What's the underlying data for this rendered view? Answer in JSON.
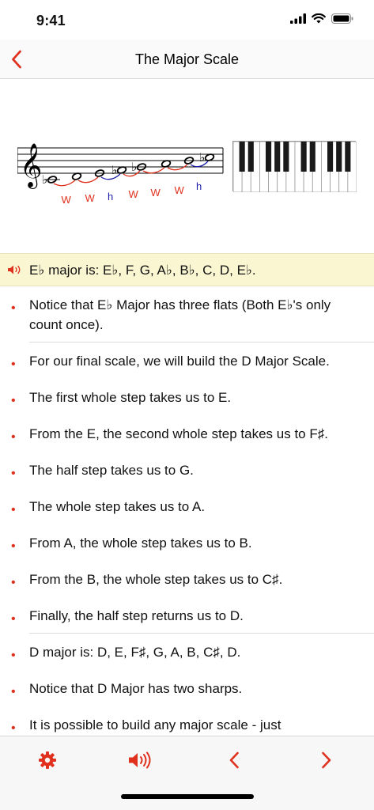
{
  "status": {
    "time": "9:41"
  },
  "nav": {
    "title": "The Major Scale",
    "back_icon": "chevron-left-icon"
  },
  "figure": {
    "step_labels": [
      "W",
      "W",
      "h",
      "W",
      "W",
      "W",
      "h"
    ],
    "step_colors": {
      "whole": "#e0301e",
      "half": "#1d1da8"
    }
  },
  "highlight": {
    "text": "E♭ major is: E♭, F, G, A♭, B♭, C, D, E♭."
  },
  "items": [
    "Notice that E♭ Major has three flats (Both E♭'s only count once).",
    "For our final scale, we will build the D Major Scale.",
    "The first whole step takes us to E.",
    "From the E, the second whole step takes us to F♯.",
    "The half step takes us to G.",
    "The whole step takes us to A.",
    "From A, the whole step takes us to B.",
    "From the B, the whole step takes us to C♯.",
    "Finally, the half step returns us to D.",
    "D major is: D, E, F♯, G, A, B, C♯, D.",
    "Notice that D Major has two sharps.",
    "It is possible to build any major scale - just"
  ],
  "toolbar": {
    "settings_icon": "gear-icon",
    "audio_icon": "speaker-icon",
    "prev_icon": "chevron-left-icon",
    "next_icon": "chevron-right-icon"
  },
  "accent_color": "#e0301e"
}
